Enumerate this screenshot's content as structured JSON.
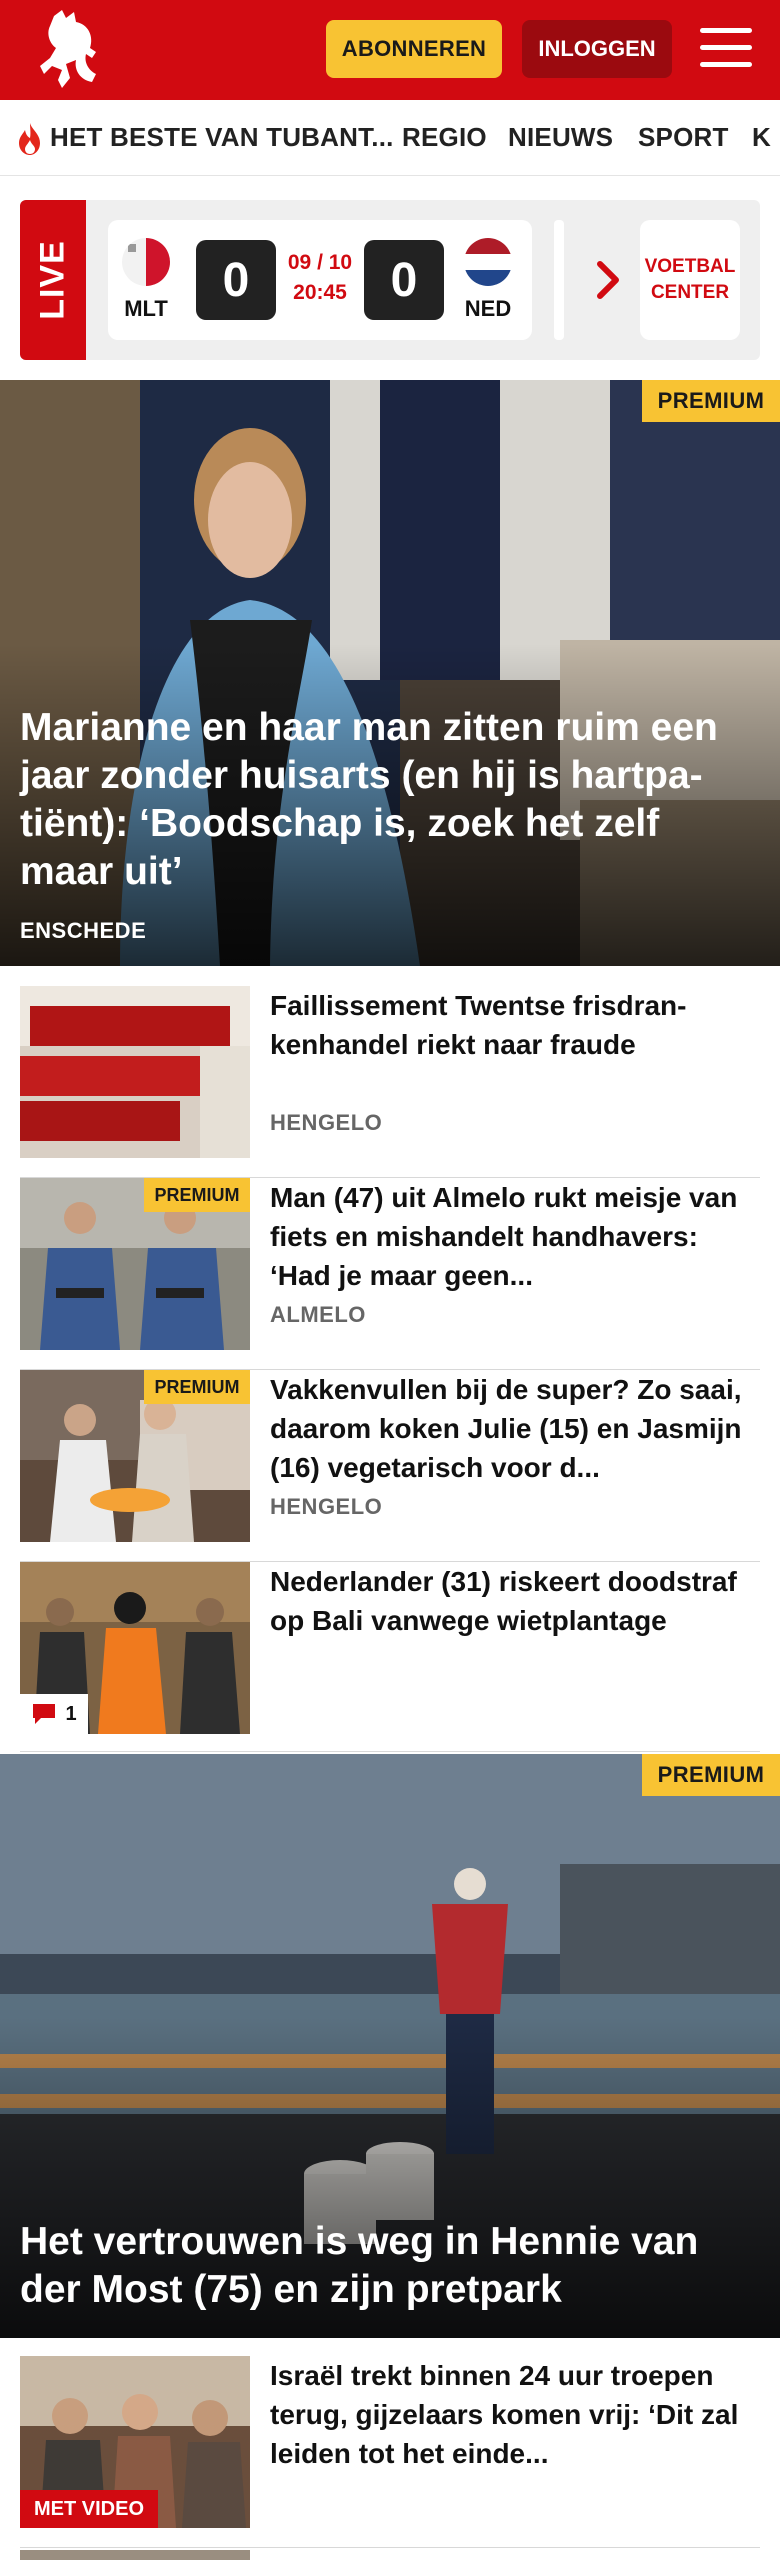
{
  "header": {
    "logo_icon": "tubantia-horse-logo",
    "subscribe_label": "ABONNEREN",
    "login_label": "INLOGGEN",
    "menu_icon": "hamburger-menu-icon",
    "brand_color": "#d10a11",
    "accent_color": "#f8c333"
  },
  "nav": {
    "items": [
      {
        "label": "HET BESTE VAN TUBANT..."
      },
      {
        "label": "REGIO"
      },
      {
        "label": "NIEUWS"
      },
      {
        "label": "SPORT"
      },
      {
        "label": "K"
      }
    ]
  },
  "live": {
    "label": "LIVE",
    "match": {
      "home_code": "MLT",
      "away_code": "NED",
      "home_score": "0",
      "away_score": "0",
      "date": "09 / 10",
      "time": "20:45"
    },
    "voetbal_center": "VOETBAL CENTER"
  },
  "articles": [
    {
      "premium_label": "PREMIUM",
      "title": "Marianne en haar man zitten ruim een jaar zonder huisarts (en hij is hartpa-tiënt): ‘Boodschap is, zoek het zelf maar uit’",
      "location": "ENSCHEDE"
    },
    {
      "title": "Faillissement Twentse frisdran-kenhandel riekt naar fraude",
      "location": "HENGELO"
    },
    {
      "premium_label": "PREMIUM",
      "title": "Man (47) uit Almelo rukt meisje van fiets en mishandelt handhavers: ‘Had je maar geen...",
      "location": "ALMELO"
    },
    {
      "premium_label": "PREMIUM",
      "title": "Vakkenvullen bij de super? Zo saai, daarom koken Julie (15) en Jasmijn (16) vegetarisch voor d...",
      "location": "HENGELO"
    },
    {
      "title": "Nederlander (31) riskeert doodstraf op Bali vanwege wietplantage",
      "comments": "1"
    },
    {
      "premium_label": "PREMIUM",
      "title": "Het vertrouwen is weg in Hennie van der Most (75) en zijn pretpark"
    },
    {
      "title": "Israël trekt binnen 24 uur troepen terug, gijzelaars komen vrij: ‘Dit zal leiden tot het einde...",
      "video_label": "MET VIDEO"
    }
  ]
}
